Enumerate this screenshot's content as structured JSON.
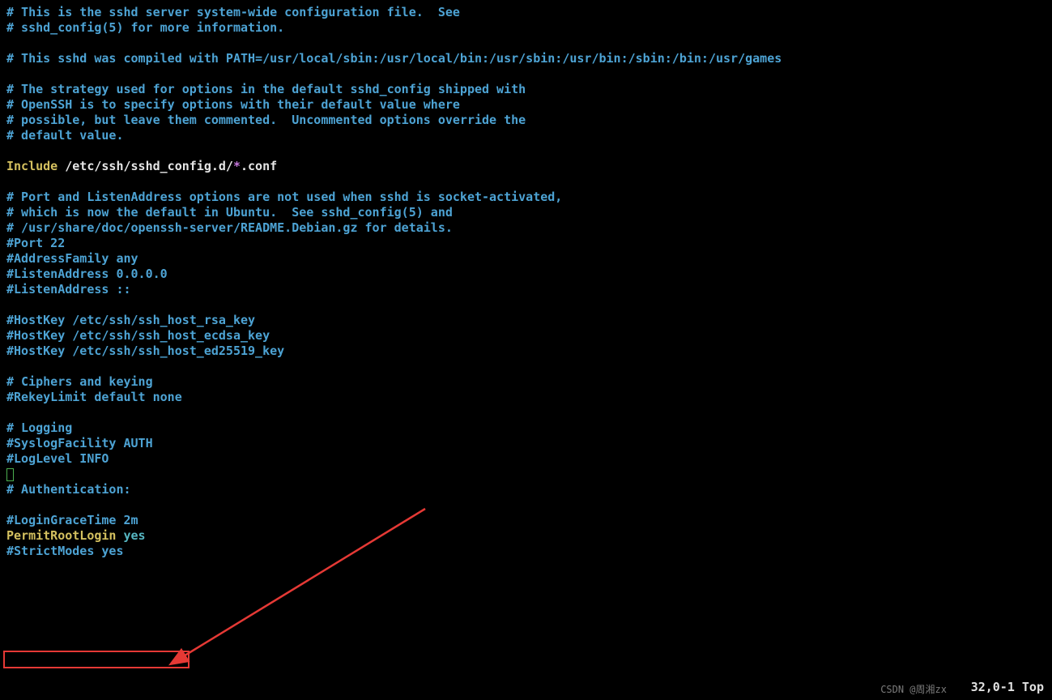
{
  "lines": {
    "l1": "# This is the sshd server system-wide configuration file.  See",
    "l2": "# sshd_config(5) for more information.",
    "l3": "",
    "l4": "# This sshd was compiled with PATH=/usr/local/sbin:/usr/local/bin:/usr/sbin:/usr/bin:/sbin:/bin:/usr/games",
    "l5": "",
    "l6": "# The strategy used for options in the default sshd_config shipped with",
    "l7": "# OpenSSH is to specify options with their default value where",
    "l8": "# possible, but leave them commented.  Uncommented options override the",
    "l9": "# default value.",
    "l10": "",
    "l11_key": "Include",
    "l11_path": " /etc/ssh/sshd_config.d/",
    "l11_star": "*",
    "l11_ext": ".conf",
    "l12": "",
    "l13": "# Port and ListenAddress options are not used when sshd is socket-activated,",
    "l14": "# which is now the default in Ubuntu.  See sshd_config(5) and",
    "l15": "# /usr/share/doc/openssh-server/README.Debian.gz for details.",
    "l16": "#Port 22",
    "l17": "#AddressFamily any",
    "l18": "#ListenAddress 0.0.0.0",
    "l19": "#ListenAddress ::",
    "l20": "",
    "l21": "#HostKey /etc/ssh/ssh_host_rsa_key",
    "l22": "#HostKey /etc/ssh/ssh_host_ecdsa_key",
    "l23": "#HostKey /etc/ssh/ssh_host_ed25519_key",
    "l24": "",
    "l25": "# Ciphers and keying",
    "l26": "#RekeyLimit default none",
    "l27": "",
    "l28": "# Logging",
    "l29": "#SyslogFacility AUTH",
    "l30": "#LogLevel INFO",
    "l31": "",
    "l32": "# Authentication:",
    "l33": "",
    "l34": "#LoginGraceTime 2m",
    "l35_key": "PermitRootLogin",
    "l35_val": " yes",
    "l36": "#StrictModes yes"
  },
  "status": {
    "position": "32,0-1",
    "scroll": "Top"
  },
  "watermark": "CSDN @周湘zx"
}
